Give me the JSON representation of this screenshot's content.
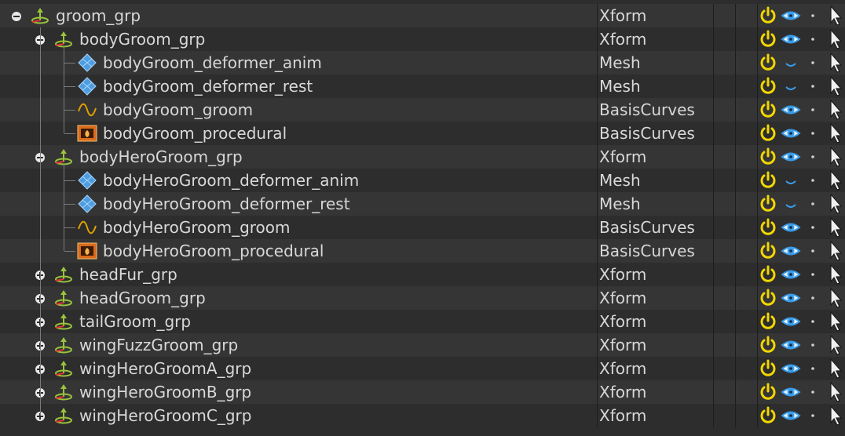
{
  "colors": {
    "row_even": "#353535",
    "row_odd": "#2d2d2d",
    "text": "#d8d8d8",
    "active_icon": "#f2d600",
    "visible_icon": "#3a9be8",
    "xform_icon": "#9ac43c",
    "mesh_icon": "#4e9de0",
    "curve_icon": "#e0a000",
    "procedural_icon": "#d96a1c"
  },
  "rows": [
    {
      "name": "groom_grp",
      "type": "Xform",
      "depth": 0,
      "expander": "minus",
      "icon": "xform-icon",
      "visible": "open"
    },
    {
      "name": "bodyGroom_grp",
      "type": "Xform",
      "depth": 1,
      "expander": "minus",
      "icon": "xform-icon",
      "visible": "open"
    },
    {
      "name": "bodyGroom_deformer_anim",
      "type": "Mesh",
      "depth": 2,
      "expander": "none",
      "icon": "mesh-icon",
      "visible": "closed"
    },
    {
      "name": "bodyGroom_deformer_rest",
      "type": "Mesh",
      "depth": 2,
      "expander": "none",
      "icon": "mesh-icon",
      "visible": "closed"
    },
    {
      "name": "bodyGroom_groom",
      "type": "BasisCurves",
      "depth": 2,
      "expander": "none",
      "icon": "curve-icon",
      "visible": "open"
    },
    {
      "name": "bodyGroom_procedural",
      "type": "BasisCurves",
      "depth": 2,
      "expander": "none",
      "icon": "procedural-icon",
      "visible": "open"
    },
    {
      "name": "bodyHeroGroom_grp",
      "type": "Xform",
      "depth": 1,
      "expander": "minus",
      "icon": "xform-icon",
      "visible": "open"
    },
    {
      "name": "bodyHeroGroom_deformer_anim",
      "type": "Mesh",
      "depth": 2,
      "expander": "none",
      "icon": "mesh-icon",
      "visible": "closed"
    },
    {
      "name": "bodyHeroGroom_deformer_rest",
      "type": "Mesh",
      "depth": 2,
      "expander": "none",
      "icon": "mesh-icon",
      "visible": "closed"
    },
    {
      "name": "bodyHeroGroom_groom",
      "type": "BasisCurves",
      "depth": 2,
      "expander": "none",
      "icon": "curve-icon",
      "visible": "open"
    },
    {
      "name": "bodyHeroGroom_procedural",
      "type": "BasisCurves",
      "depth": 2,
      "expander": "none",
      "icon": "procedural-icon",
      "visible": "open"
    },
    {
      "name": "headFur_grp",
      "type": "Xform",
      "depth": 1,
      "expander": "plus",
      "icon": "xform-icon",
      "visible": "open"
    },
    {
      "name": "headGroom_grp",
      "type": "Xform",
      "depth": 1,
      "expander": "plus",
      "icon": "xform-icon",
      "visible": "open"
    },
    {
      "name": "tailGroom_grp",
      "type": "Xform",
      "depth": 1,
      "expander": "plus",
      "icon": "xform-icon",
      "visible": "open"
    },
    {
      "name": "wingFuzzGroom_grp",
      "type": "Xform",
      "depth": 1,
      "expander": "plus",
      "icon": "xform-icon",
      "visible": "open"
    },
    {
      "name": "wingHeroGroomA_grp",
      "type": "Xform",
      "depth": 1,
      "expander": "plus",
      "icon": "xform-icon",
      "visible": "open"
    },
    {
      "name": "wingHeroGroomB_grp",
      "type": "Xform",
      "depth": 1,
      "expander": "plus",
      "icon": "xform-icon",
      "visible": "open"
    },
    {
      "name": "wingHeroGroomC_grp",
      "type": "Xform",
      "depth": 1,
      "expander": "plus",
      "icon": "xform-icon",
      "visible": "open"
    }
  ]
}
